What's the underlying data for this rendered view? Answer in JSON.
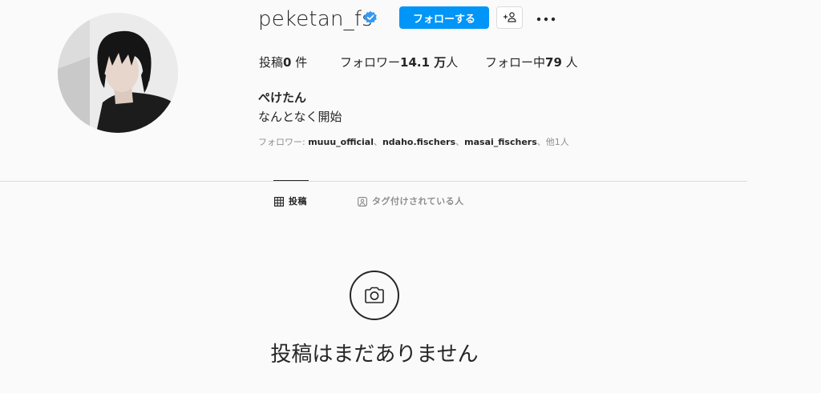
{
  "profile": {
    "username": "peketan_fs",
    "verified": true,
    "full_name": "ぺけたん",
    "bio": "なんとなく開始",
    "avatar_icon": "profile-photo"
  },
  "actions": {
    "follow_label": "フォローする",
    "suggest_icon": "add-person-icon",
    "more_icon": "more-options-icon"
  },
  "stats": {
    "posts_label": "投稿",
    "posts_value": "0",
    "posts_unit": " 件",
    "followers_label": "フォロワー",
    "followers_value": "14.1 万",
    "followers_unit": "人",
    "following_label": "フォロー中",
    "following_value": "79",
    "following_unit": " 人"
  },
  "followed_by": {
    "prefix": "フォロワー: ",
    "accounts": [
      "muuu_official",
      "ndaho.fischers",
      "masai_fischers"
    ],
    "separator": "、",
    "suffix": "、他1人"
  },
  "tabs": {
    "posts": {
      "label": "投稿",
      "icon": "grid-icon",
      "active": true
    },
    "tagged": {
      "label": "タグ付けされている人",
      "icon": "tagged-icon",
      "active": false
    }
  },
  "empty_state": {
    "icon": "camera-icon",
    "message": "投稿はまだありません"
  },
  "colors": {
    "accent": "#0095f6",
    "text": "#262626",
    "muted": "#8e8e8e",
    "border": "#dbdbdb",
    "background": "#fafafa"
  }
}
